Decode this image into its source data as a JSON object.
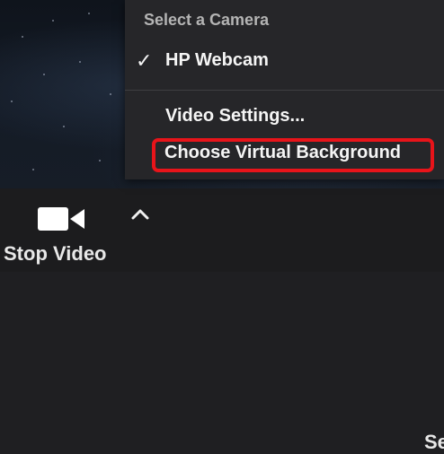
{
  "menu": {
    "header": "Select a Camera",
    "items": [
      {
        "label": "HP Webcam",
        "checked": true
      },
      {
        "label": "Video Settings..."
      },
      {
        "label": "Choose Virtual Background",
        "highlighted": true
      }
    ]
  },
  "toolbar": {
    "stop_video_label": "Stop Video",
    "right_partial_label": "Se"
  },
  "icons": {
    "camera": "video-camera-icon",
    "chevron": "chevron-up-icon",
    "check": "checkmark-icon"
  },
  "colors": {
    "highlight_border": "#e8141a",
    "menu_background": "#262629",
    "toolbar_background": "#1c1c1e"
  }
}
